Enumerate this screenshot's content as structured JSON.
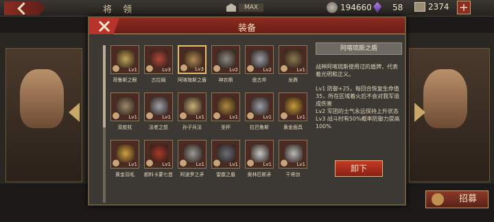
{
  "topbar": {
    "title": "将 领",
    "max_label": "MAX",
    "coins": "194660",
    "gems": "58",
    "boxes": "2374",
    "plus": "+"
  },
  "modal": {
    "title": "装备",
    "unequip_label": "卸下"
  },
  "items": [
    {
      "name": "荷鲁斯之眼",
      "level": "Lv1",
      "color": "#c2a45a",
      "selected": false
    },
    {
      "name": "古拉姆",
      "level": "Lv3",
      "color": "#b24a3c",
      "selected": false
    },
    {
      "name": "阿喀琉斯之盾",
      "level": "Lv3",
      "color": "#b08a55",
      "selected": true
    },
    {
      "name": "神农鼎",
      "level": "Lv2",
      "color": "#8a8a80",
      "selected": false
    },
    {
      "name": "盘古斧",
      "level": "Lv2",
      "color": "#9aa0a8",
      "selected": false
    },
    {
      "name": "龙鼎",
      "level": "Lv1",
      "color": "#8c7a50",
      "selected": false
    },
    {
      "name": "双蛇杖",
      "level": "Lv1",
      "color": "#9a8a6a",
      "selected": false
    },
    {
      "name": "法老之怒",
      "level": "Lv1",
      "color": "#a0a4ac",
      "selected": false
    },
    {
      "name": "孙子兵法",
      "level": "Lv1",
      "color": "#c9b07a",
      "selected": false
    },
    {
      "name": "圣杯",
      "level": "Lv1",
      "color": "#b08a40",
      "selected": false
    },
    {
      "name": "拉巴鲁斯",
      "level": "Lv1",
      "color": "#9aa0a8",
      "selected": false
    },
    {
      "name": "黄金面具",
      "level": "Lv1",
      "color": "#c89a3a",
      "selected": false
    },
    {
      "name": "黄金羽毛",
      "level": "Lv1",
      "color": "#d0a040",
      "selected": false
    },
    {
      "name": "颜料卡蒙七首",
      "level": "Lv1",
      "color": "#a83a2a",
      "selected": false
    },
    {
      "name": "阿波罗之矛",
      "level": "Lv1",
      "color": "#9a9a96",
      "selected": false
    },
    {
      "name": "雷霆之盾",
      "level": "Lv1",
      "color": "#6a7078",
      "selected": false
    },
    {
      "name": "奥林匹斯矛",
      "level": "Lv1",
      "color": "#c8c8c8",
      "selected": false
    },
    {
      "name": "干将剑",
      "level": "Lv1",
      "color": "#b8b8b8",
      "selected": false
    }
  ],
  "detail": {
    "title": "阿喀琉斯之盾",
    "description": "战神阿喀琉斯使用过的盾牌，代表着光明和正义。",
    "effects": "Lv1 防御+25，每回合恢复生命值35，所在区域着火后不会对我军造成伤害\nLv2 军团的士气永远保持上升状态\nLv3 战斗时有50%概率防御力提高100%"
  },
  "side": {
    "recruit_label": "招募"
  }
}
